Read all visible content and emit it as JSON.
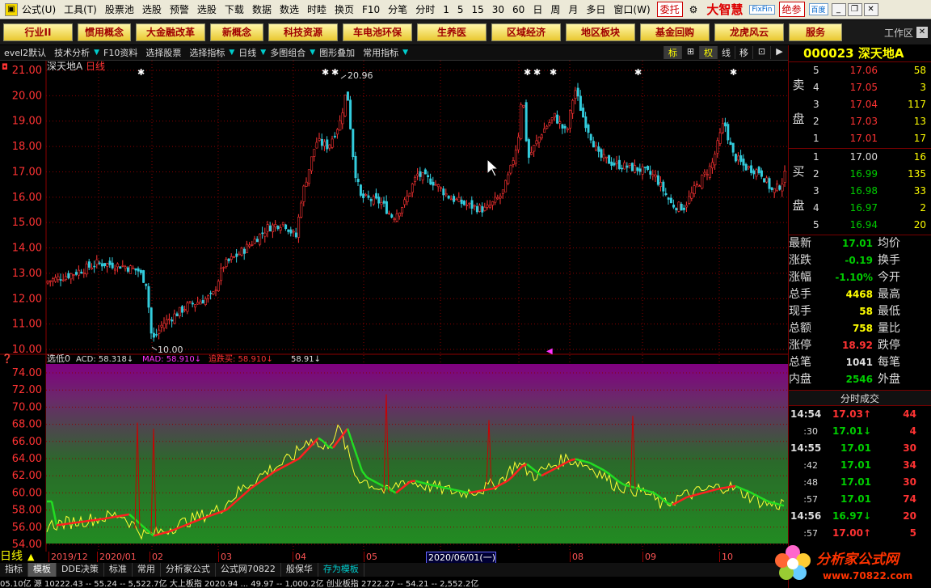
{
  "menu": {
    "items": [
      "公式(U)",
      "工具(T)",
      "股票池",
      "选股",
      "预警",
      "选股",
      "下载",
      "数据",
      "数选",
      "时睦",
      "换页",
      "F10",
      "分笔",
      "分时",
      "1",
      "5",
      "15",
      "30",
      "60",
      "日",
      "周",
      "月",
      "多日",
      "窗口(W)"
    ],
    "entrust": "委托",
    "brand": "大智慧",
    "fixfin": "FixFin",
    "jue": "绝参",
    "baidu": "百度"
  },
  "toolbar": {
    "buttons": [
      "行业II",
      "惯用概念",
      "大金融改革",
      "新概念",
      "科技资源",
      "车电池环保",
      "生养医",
      "区域经济",
      "地区板块",
      "基金回购",
      "龙虎风云",
      "服务"
    ],
    "workarea": "工作区"
  },
  "subbar": {
    "items": [
      "evel2默认",
      "技术分析",
      "F10资料",
      "选择股票",
      "选择指标",
      "日线",
      "多图组合",
      "图形叠加",
      "常用指标"
    ],
    "right": [
      "标",
      "⊞",
      "权",
      "线",
      "移",
      "⊡",
      "▶"
    ]
  },
  "chart": {
    "title": "深天地A",
    "period": "日线",
    "ylabels": [
      "21.00",
      "20.00",
      "19.00",
      "18.00",
      "17.00",
      "16.00",
      "15.00",
      "14.00",
      "13.00",
      "12.00",
      "11.00",
      "10.00"
    ],
    "high_label": "20.96",
    "low_label": "10.00",
    "ind_header": {
      "name": "选低0",
      "acd": "ACD: 58.318↓",
      "mad": "MAD: 58.910↓",
      "buy": "追跌买: 58.910↓",
      "last": "58.91↓"
    },
    "ind_ylabels": [
      "74.00",
      "72.00",
      "70.00",
      "68.00",
      "66.00",
      "64.00",
      "62.00",
      "60.00",
      "58.00",
      "56.00",
      "54.00"
    ]
  },
  "colors": {
    "up": "#ff3333",
    "down": "#33ccdd",
    "grid": "#8b0000",
    "accent": "#ffff00"
  },
  "dates": [
    "2019/12",
    "2020/01",
    "02",
    "03",
    "04",
    "05",
    "2020/06/01(一)",
    "08",
    "09",
    "10"
  ],
  "day_label": "日线",
  "bottom_tabs": [
    "指标",
    "模板",
    "DDE决策",
    "标准",
    "常用",
    "分析家公式",
    "公式网70822",
    "般保华",
    "存为模板"
  ],
  "ticker_text": "05.10亿 源    10222.43 -- 55.24 -- 5,522.7亿 大上板指    2020.94    ... 49.97 -- 1,000.2亿 创业板指   2722.27 -- 54.21 --  2,552.2亿",
  "quote": {
    "code": "000023",
    "name": "深天地A",
    "sell": [
      {
        "l": "5",
        "p": "17.06",
        "v": "58"
      },
      {
        "l": "4",
        "p": "17.05",
        "v": "3"
      },
      {
        "l": "3",
        "p": "17.04",
        "v": "117"
      },
      {
        "l": "2",
        "p": "17.03",
        "v": "13"
      },
      {
        "l": "1",
        "p": "17.01",
        "v": "17"
      }
    ],
    "buy": [
      {
        "l": "1",
        "p": "17.00",
        "v": "16"
      },
      {
        "l": "2",
        "p": "16.99",
        "v": "135"
      },
      {
        "l": "3",
        "p": "16.98",
        "v": "33"
      },
      {
        "l": "4",
        "p": "16.97",
        "v": "2"
      },
      {
        "l": "5",
        "p": "16.94",
        "v": "20"
      }
    ],
    "sell_label": [
      "卖",
      "盘"
    ],
    "buy_label": [
      "买",
      "盘"
    ],
    "stats": [
      {
        "k": "最新",
        "v": "17.01",
        "c": "dn",
        "k2": "均价"
      },
      {
        "k": "涨跌",
        "v": "-0.19",
        "c": "dn",
        "k2": "换手"
      },
      {
        "k": "涨幅",
        "v": "-1.10%",
        "c": "dn",
        "k2": "今开"
      },
      {
        "k": "总手",
        "v": "4468",
        "c": "yl",
        "k2": "最高"
      },
      {
        "k": "现手",
        "v": "58",
        "c": "yl",
        "k2": "最低"
      },
      {
        "k": "总额",
        "v": "758",
        "c": "yl",
        "k2": "量比"
      },
      {
        "k": "涨停",
        "v": "18.92",
        "c": "up",
        "k2": "跌停"
      },
      {
        "k": "总笔",
        "v": "1041",
        "c": "wt",
        "k2": "每笔"
      },
      {
        "k": "内盘",
        "v": "2546",
        "c": "dn",
        "k2": "外盘"
      }
    ],
    "ticks_header": "分时成交",
    "ticks": [
      {
        "t": "14:54",
        "p": "17.03↑",
        "pc": "up",
        "v": "44",
        "vc": "up"
      },
      {
        "t": ":30",
        "p": "17.01↓",
        "pc": "dn",
        "v": "4",
        "vc": "up"
      },
      {
        "t": "14:55",
        "p": "17.01",
        "pc": "dn",
        "v": "30",
        "vc": "up"
      },
      {
        "t": ":42",
        "p": "17.01",
        "pc": "dn",
        "v": "34",
        "vc": "up"
      },
      {
        "t": ":48",
        "p": "17.01",
        "pc": "dn",
        "v": "30",
        "vc": "up"
      },
      {
        "t": ":57",
        "p": "17.01",
        "pc": "dn",
        "v": "74",
        "vc": "up"
      },
      {
        "t": "14:56",
        "p": "16.97↓",
        "pc": "dn",
        "v": "20",
        "vc": "up"
      },
      {
        "t": ":57",
        "p": "17.00↑",
        "pc": "up",
        "v": "5",
        "vc": "up"
      }
    ]
  },
  "watermark": {
    "t1": "分析家公式网",
    "t2": "www.70822.com"
  }
}
